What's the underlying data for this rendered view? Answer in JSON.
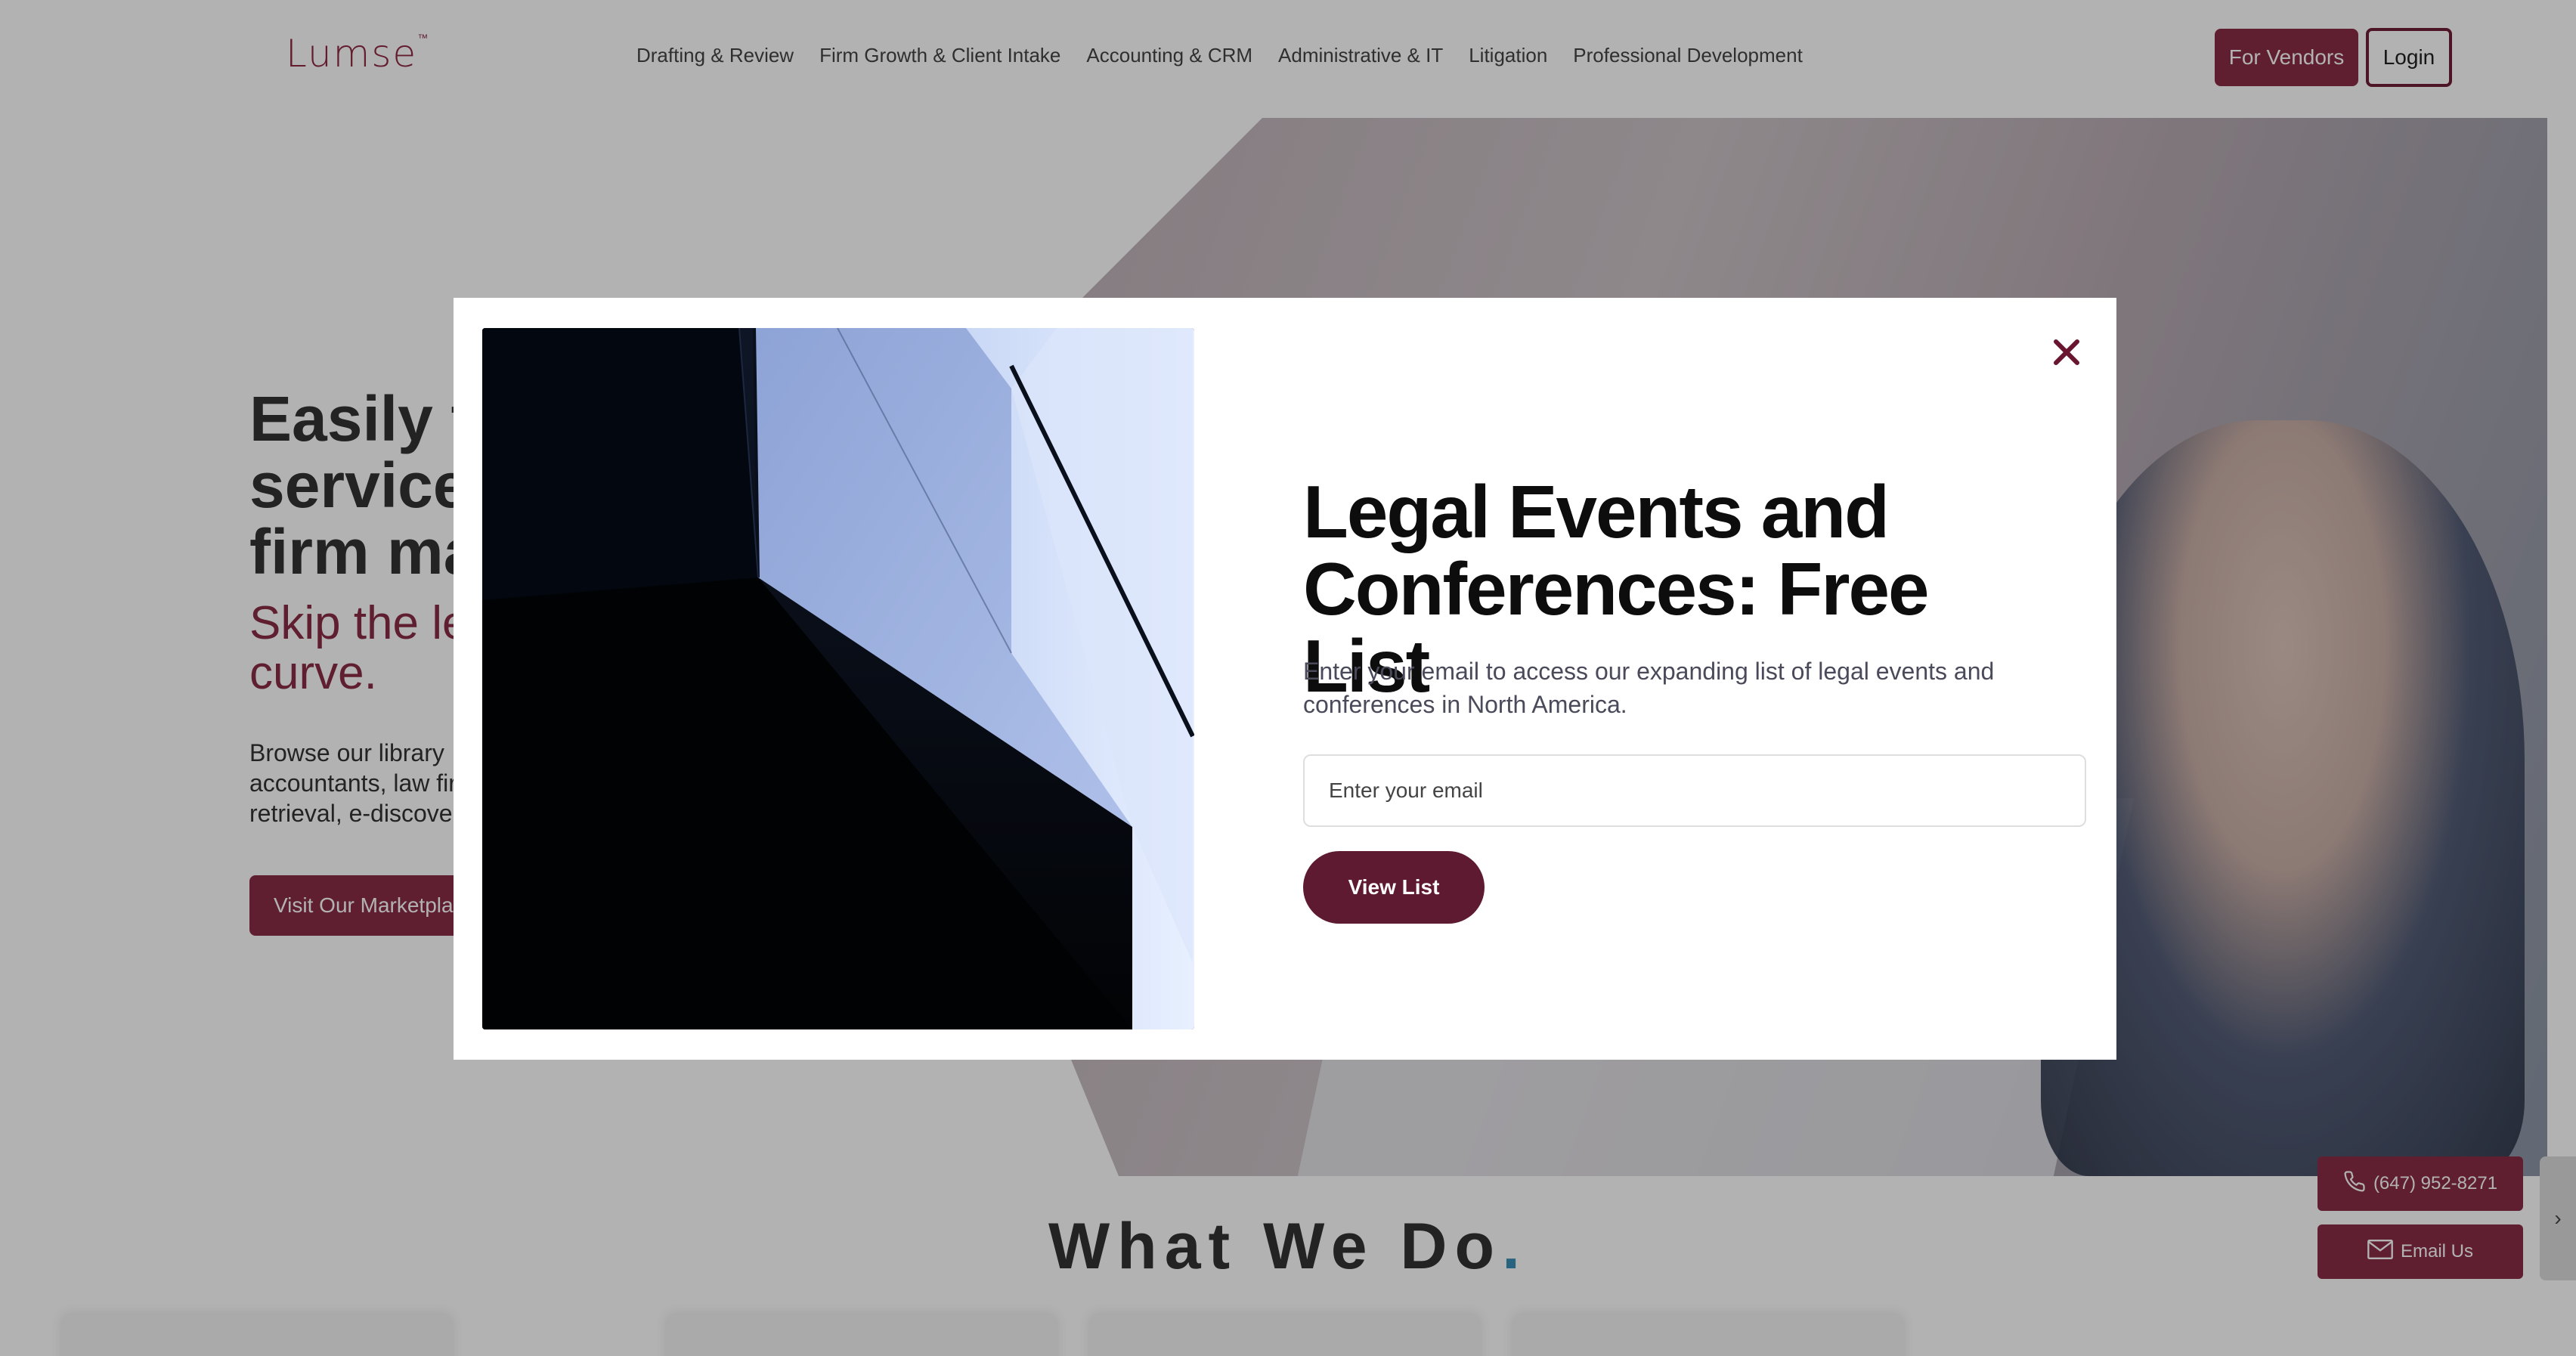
{
  "header": {
    "logo_text": "Lumse",
    "logo_tm": "™",
    "nav": [
      {
        "label": "Drafting & Review"
      },
      {
        "label": "Firm Growth & Client Intake"
      },
      {
        "label": "Accounting & CRM"
      },
      {
        "label": "Administrative & IT"
      },
      {
        "label": "Litigation"
      },
      {
        "label": "Professional Development"
      }
    ],
    "vendors_label": "For Vendors",
    "login_label": "Login"
  },
  "hero": {
    "headline": "Easily fi services firm ma",
    "headline_lines": [
      "Easily fi",
      "services",
      "firm ma"
    ],
    "subheadline_lines": [
      "Skip the le",
      "curve."
    ],
    "body_lines": [
      "Browse our library",
      "accountants, law fir",
      "retrieval, e-discove"
    ],
    "cta_label": "Visit Our Marketpla"
  },
  "section": {
    "title": "What We Do",
    "title_dot": "."
  },
  "floating": {
    "phone_label": "(647) 952-8271",
    "email_label": "Email Us",
    "side_tab_glyph": "›"
  },
  "modal": {
    "title": "Legal Events and Conferences: Free List",
    "description": "Enter your email to access our expanding list of legal events and conferences in North America.",
    "email_placeholder": "Enter your email",
    "email_value": "",
    "submit_label": "View List",
    "close_glyph": "✕"
  },
  "colors": {
    "brand": "#8a2d46",
    "brand_dark": "#5e1a31",
    "accent_dot": "#3a8fb7"
  },
  "icons": {
    "close": "close-icon",
    "phone": "phone-icon",
    "email": "mail-icon",
    "chevron": "chevron-right-icon"
  }
}
